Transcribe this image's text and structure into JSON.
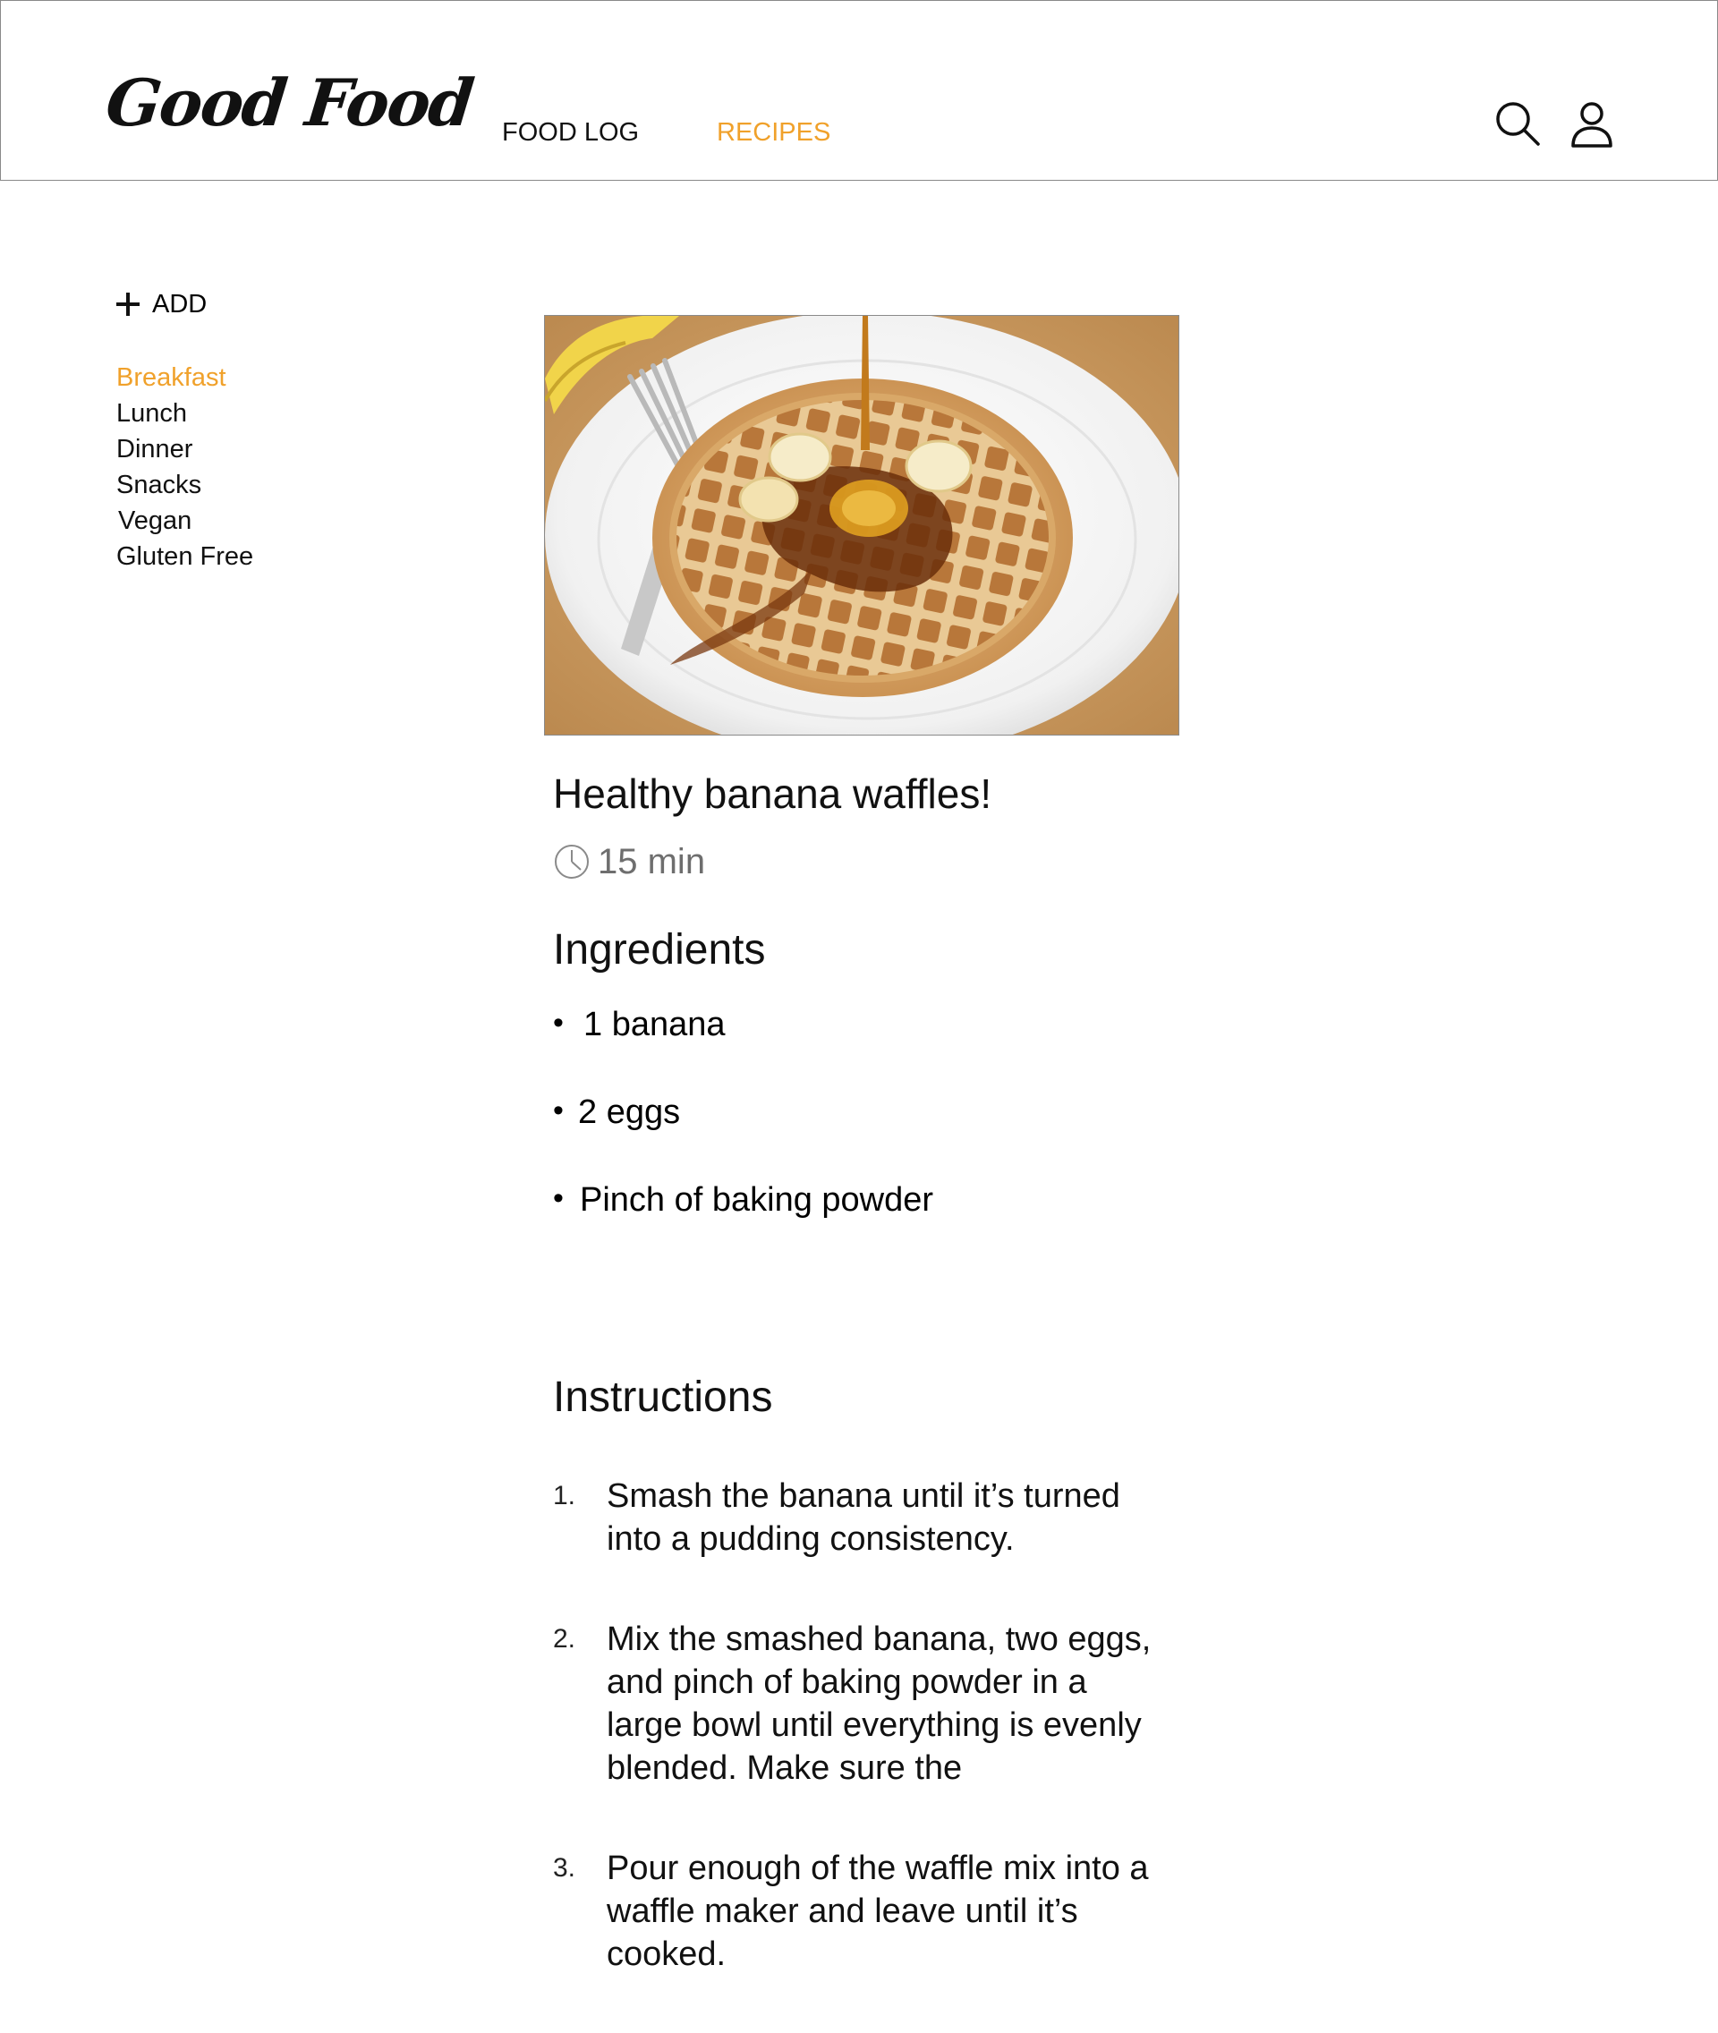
{
  "app": {
    "logo": "Good Food"
  },
  "nav": {
    "food_log": "FOOD LOG",
    "recipes": "RECIPES",
    "active": "RECIPES"
  },
  "header_icons": {
    "search": "search-icon",
    "user": "user-icon"
  },
  "sidebar": {
    "add_label": "ADD",
    "categories": [
      {
        "label": "Breakfast",
        "active": true
      },
      {
        "label": "Lunch",
        "active": false
      },
      {
        "label": "Dinner",
        "active": false
      },
      {
        "label": "Snacks",
        "active": false
      },
      {
        "label": "Vegan",
        "active": false
      },
      {
        "label": "Gluten Free",
        "active": false
      }
    ]
  },
  "recipe": {
    "title": "Healthy banana waffles!",
    "time": "15 min",
    "ingredients_heading": "Ingredients",
    "ingredients": [
      "1 banana",
      "2 eggs",
      "Pinch of baking powder"
    ],
    "instructions_heading": "Instructions",
    "steps": [
      {
        "num": "1.",
        "text": "Smash the banana until it’s turned into a pudding consistency."
      },
      {
        "num": "2.",
        "text": "Mix the smashed banana, two eggs, and pinch of baking powder in a large bowl until everything is evenly blended. Make sure the"
      },
      {
        "num": "3.",
        "text": "Pour enough of the waffle mix into a waffle maker and leave until it’s cooked."
      }
    ]
  },
  "colors": {
    "accent": "#f0a12b",
    "text": "#111111",
    "muted": "#6e6e6e",
    "border": "#8a8a8a"
  }
}
